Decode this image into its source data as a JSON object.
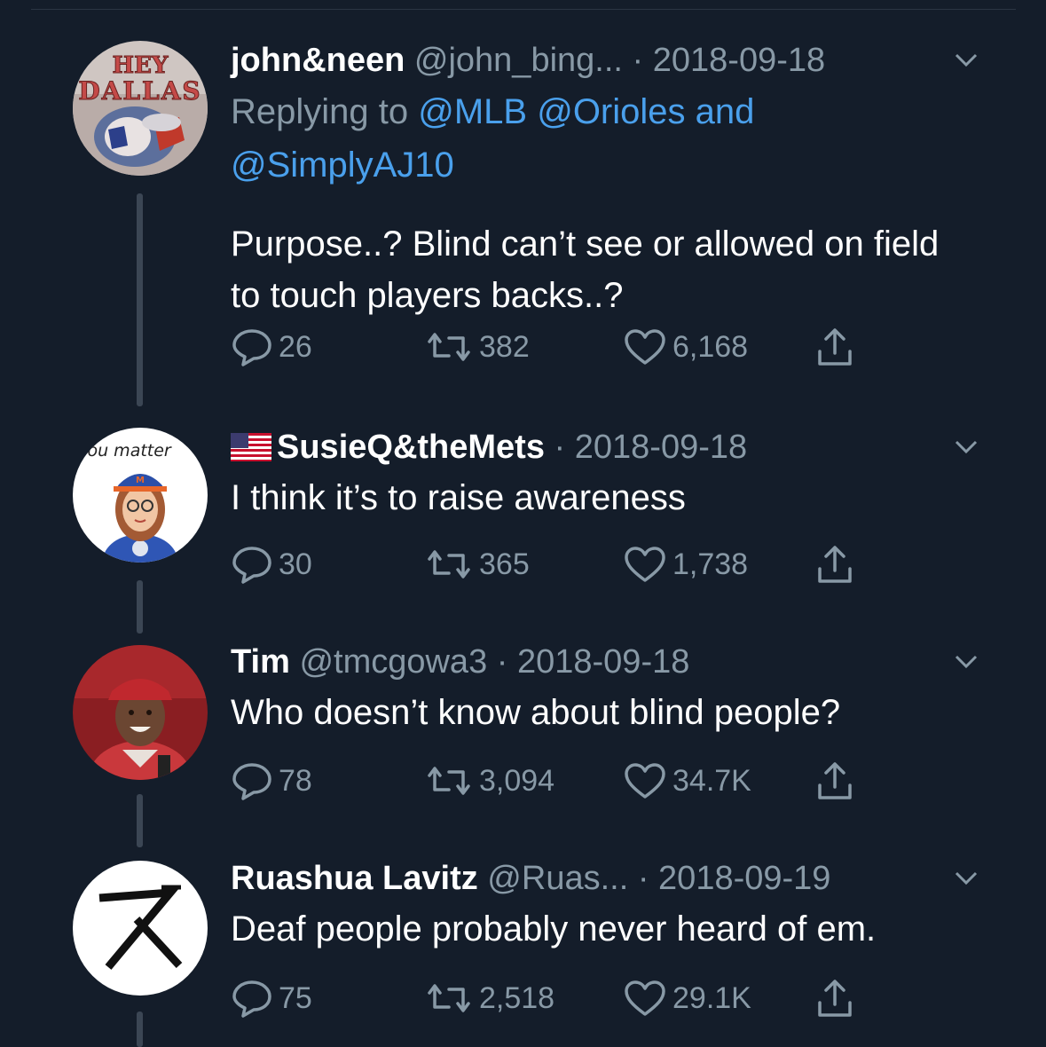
{
  "tweets": [
    {
      "display_name": "john&neen",
      "handle": "@john_bing...",
      "separator": "·",
      "date": "2018-09-18",
      "replying_prefix": "Replying to",
      "replying_mentions_line1": "@MLB @Orioles and",
      "replying_mentions_line2": "@SimplyAJ10",
      "text": "Purpose..? Blind can’t see or allowed on field to touch players backs..?",
      "replies": "26",
      "retweets": "382",
      "likes": "6,168",
      "avatar_text_top": "HEY",
      "avatar_text_bottom": "DALLAS"
    },
    {
      "display_name": "SusieQ&theMets",
      "separator": "·",
      "date": "2018-09-18",
      "text": "I think it’s to raise awareness",
      "replies": "30",
      "retweets": "365",
      "likes": "1,738",
      "avatar_text": "you matter",
      "flag_icon": "us-flag-icon"
    },
    {
      "display_name": "Tim",
      "handle": "@tmcgowa3",
      "separator": "·",
      "date": "2018-09-18",
      "text": "Who doesn’t know about blind people?",
      "replies": "78",
      "retweets": "3,094",
      "likes": "34.7K"
    },
    {
      "display_name": "Ruashua Lavitz",
      "handle": "@Ruas...",
      "separator": "·",
      "date": "2018-09-19",
      "text": "Deaf people probably never heard of em.",
      "replies": "75",
      "retweets": "2,518",
      "likes": "29.1K"
    }
  ],
  "colors": {
    "background": "#141d2a",
    "secondary_text": "#8899a6",
    "link": "#4aa0ec",
    "thread_line": "#3b4654"
  },
  "icons": [
    "reply-icon",
    "retweet-icon",
    "like-icon",
    "share-icon",
    "chevron-down-icon"
  ]
}
